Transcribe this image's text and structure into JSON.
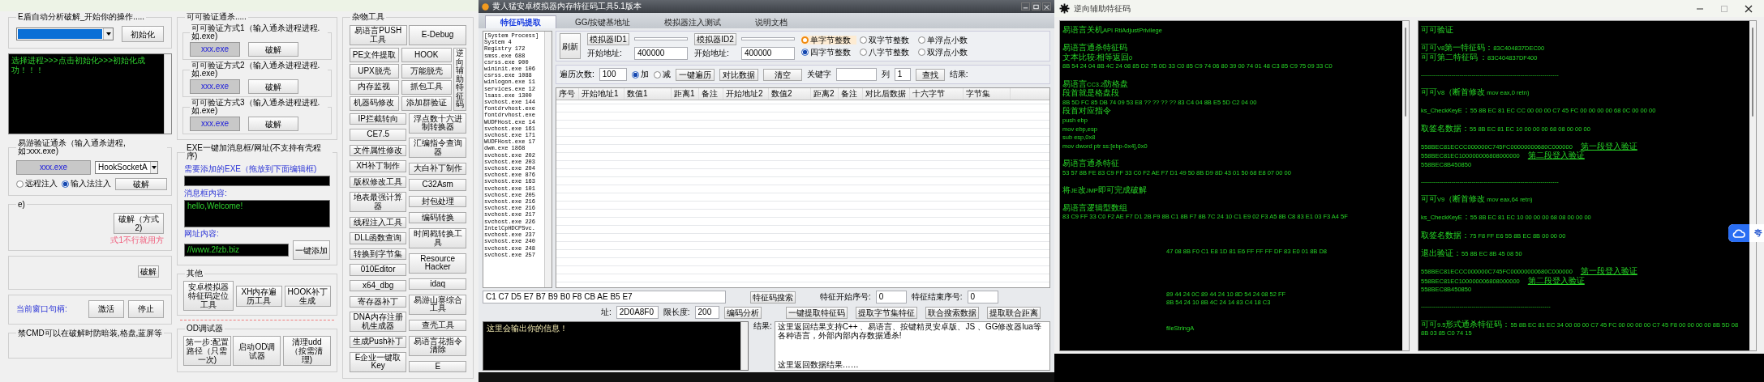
{
  "left_window": {
    "e_shield": {
      "title": "E盾自动分析破解_开始你的操作.....",
      "button": "初始化",
      "log": "选择进程>>>点击初始化>>>初始化成功！！！"
    },
    "yiyou": {
      "title": "易游验证通杀（输入通杀进程,如:xxx.exe)",
      "process": "xxx.exe",
      "hook": "HookSocketA",
      "modes": [
        {
          "label": "远程注入",
          "selected": false
        },
        {
          "label": "输入法注入",
          "selected": true
        }
      ],
      "button": "破解"
    },
    "method2": {
      "title": "e)",
      "button": "破解（方式2)",
      "hint": "式1不行就用方"
    },
    "thunder": {
      "button": "破解"
    },
    "window_ctrl": {
      "label": "当前窗口句柄:",
      "buttons": [
        "激活",
        "停止"
      ]
    },
    "cmd": {
      "title": "禁CMD可以在破解时防暗装,格盘,蓝屏等"
    },
    "keke": {
      "title": "可可验证通杀.....",
      "methods": [
        {
          "title": "可可验证方式1（输入通杀进程进程.如.exe)",
          "process": "xxx.exe",
          "button": "破解"
        },
        {
          "title": "可可验证方式2（输入通杀进程进程.如.exe)",
          "process": "xxx.exe",
          "button": "破解"
        },
        {
          "title": "可可验证方式3（输入通杀进程进程.如.exe)",
          "process": "xxx.exe",
          "button": "破解"
        }
      ]
    },
    "exe_msg": {
      "title": "EXE一键加消息框/网址(不支持有壳程序)",
      "exe_label": "需要添加的EXE（拖放到下面编辑框)",
      "msg_label": "消息框内容:",
      "msg": "hello,Welcome!",
      "url_label": "网址内容:",
      "url": "//www.2fzb.biz",
      "button": "一键添加"
    },
    "other": {
      "title": "其他",
      "buttons": [
        "安卓模拟器特征码定位工具",
        "XH内存遍历工具",
        "HOOK补丁生成"
      ]
    },
    "od": {
      "title": "OD调试器",
      "buttons": [
        "第一步:配置路径（只需一次)",
        "启动OD调试器",
        "清理udd（按需清理)"
      ]
    },
    "tools": {
      "title": "杂物工具",
      "first_row": [
        "易语言PUSH工具",
        "E-Debug"
      ],
      "grid": [
        "PE文件提取",
        "HOOK",
        "UPX脱壳",
        "万能脱壳",
        "内存监视",
        "抓包工具",
        "机器码修改",
        "添加群验证"
      ],
      "vertical": "逆向辅助特征码",
      "left_column": [
        "IP拦截转向",
        "CE7.5",
        "文件属性修改",
        "XH补丁制作",
        "版权修改工具",
        "地表最强计算器",
        "线程注入工具",
        "DLL函数查询",
        "转换到字节集",
        "010Editor",
        "x64_dbg",
        "寄存器补丁",
        "DNA内存注册机生成器",
        "生成Push补丁",
        "E企业一键取Key"
      ],
      "right_column": [
        "浮点数十六进制转换器",
        "汇编指令查询器",
        "大白补丁制作",
        "C32Asm",
        "封包处理",
        "编码转换",
        "时间戳转换工具",
        "Resource Hacker",
        "idaq",
        "易游山寨综合工具",
        "查壳工具",
        "易语言花指令清除",
        "E"
      ]
    }
  },
  "main_window": {
    "title": "黄人猛安卓模拟器内存特征码工具5.1版本",
    "tabs": [
      {
        "label": "特征码提取",
        "selected": true
      },
      {
        "label": "GG/按键基地址",
        "selected": false
      },
      {
        "label": "模拟器注入测试",
        "selected": false
      },
      {
        "label": "说明文档",
        "selected": false
      }
    ],
    "processes": [
      "[System Process]",
      "System 4",
      "Registry 172",
      "smss.exe 688",
      "csrss.exe 900",
      "wininit.exe 106",
      "csrss.exe 1088",
      "winlogon.exe 11",
      "services.exe 12",
      "lsass.exe 1300",
      "svchost.exe 144",
      "fontdrvhost.exe",
      "fontdrvhost.exe",
      "WUDFHost.exe 14",
      "svchost.exe 161",
      "svchost.exe 171",
      "WUDFHost.exe 17",
      "dwm.exe 1868",
      "svchost.exe 202",
      "svchost.exe 203",
      "svchost.exe 204",
      "svchost.exe 876",
      "svchost.exe 163",
      "svchost.exe 101",
      "svchost.exe 205",
      "svchost.exe 216",
      "svchost.exe 216",
      "svchost.exe 217",
      "svchost.exe 226",
      "IntelCpHDCPSvc.",
      "svchost.exe 237",
      "svchost.exe 240",
      "svchost.exe 248",
      "svchost.exe 257"
    ],
    "refresh": "刷新",
    "emulators": [
      {
        "button": "模拟器ID1",
        "start_label": "开始地址:",
        "start": "400000"
      },
      {
        "button": "模拟器ID2",
        "start_label": "开始地址:",
        "start": "400000"
      }
    ],
    "value_types": [
      {
        "label": "单字节整数",
        "selected": false,
        "highlighted": true
      },
      {
        "label": "双字节整数",
        "selected": false,
        "highlighted": false
      },
      {
        "label": "单浮点小数",
        "selected": false,
        "highlighted": false
      },
      {
        "label": "四字节整数",
        "selected": true,
        "highlighted": false
      },
      {
        "label": "八字节整数",
        "selected": false,
        "highlighted": false
      },
      {
        "label": "双浮点小数",
        "selected": false,
        "highlighted": false
      }
    ],
    "iterations_label": "遍历次数:",
    "iterations": "100",
    "directions": [
      {
        "label": "加",
        "selected": true
      },
      {
        "label": "减",
        "selected": false
      }
    ],
    "actions": [
      "一键遍历",
      "对比数据",
      "清空"
    ],
    "keyword_label": "关键字",
    "column_label": "列",
    "column": "1",
    "find": "查找",
    "result_label": "结果:",
    "columns": [
      "序号",
      "开始地址1",
      "数值1",
      "距离1",
      "备注",
      "开始地址2",
      "数值2",
      "距离2",
      "备注",
      "对比后数据",
      "十六字节",
      "字节集"
    ],
    "bytes": "C1 C7 D5 E7 B7 B9 B0 F8 CB AE B5 E7",
    "search": "特征码搜索",
    "feature_start_label": "特征开始序号:",
    "feature_start": "0",
    "feature_end_label": "特征结束序号:",
    "feature_end": "0",
    "address_label": "址:",
    "address": "2D0A8F0",
    "limit_label": "限长度:",
    "limit": "200",
    "analyze": "编码分析",
    "extract_buttons": [
      "一键提取特征码",
      "提取字节集特征",
      "联合搜索数据",
      "提取联合距离"
    ],
    "log": "这里会输出你的信息！",
    "output_label": "结果:",
    "output_lines": [
      "这里返回结果支持C++ 、易语言、按键精灵安卓版、JS 、GG修改器lua等各种语言，外部内部内存数据通杀!",
      "这里返回数据结果……"
    ]
  },
  "reverse_window": {
    "title": "逆向辅助特征码",
    "left_pane": [
      {
        "kind": "text",
        "text": "易语言关机API RtlAdjustPrivilege"
      },
      {
        "kind": "blank"
      },
      {
        "kind": "text",
        "text": "易语言通杀特征码"
      },
      {
        "kind": "text",
        "text": "文本比较:相等返回0"
      },
      {
        "kind": "text",
        "text": "8B 54 24 04 8B 4C 24 08 85 D2 75 0D 33 C0 85 C9 74 06 80 39 00 74 01 48 C3 85 C9 75 09 33 C0"
      },
      {
        "kind": "blank"
      },
      {
        "kind": "text",
        "text": "易语言CC3.2防格盘"
      },
      {
        "kind": "text",
        "text": "段首就是格盘段"
      },
      {
        "kind": "text",
        "text": "8B 5D FC 85 DB 74 09 53 E8 ?? ?? ?? ?? 83 C4 04 8B E5 5D C2 04 00"
      },
      {
        "kind": "text",
        "text": "段首对应指令"
      },
      {
        "kind": "text",
        "text": "push ebp"
      },
      {
        "kind": "text",
        "text": "mov ebp,esp"
      },
      {
        "kind": "text",
        "text": "sub esp,0x8"
      },
      {
        "kind": "text",
        "text": "mov dword ptr ss:[ebp-0x4],0x0"
      },
      {
        "kind": "blank"
      },
      {
        "kind": "text",
        "text": "易语言通杀特征"
      },
      {
        "kind": "text",
        "text": "53 57 8B FE 83 C9 FF 33 C0 F2 AE F7 D1 49 50 8B D9 8D 43 01 50 68 E8 07 00 00"
      },
      {
        "kind": "blank"
      },
      {
        "kind": "text",
        "text": "将JE改JMP即可完成破解"
      },
      {
        "kind": "blank"
      },
      {
        "kind": "text",
        "text": "易语言逻辑型数组"
      },
      {
        "kind": "text",
        "text": "83 C9 FF 33 C0 F2 AE F7 D1 2B F9 8B C1 8B F7 8B 7C 24 10 C1 E9 02 F3 A5 8B C8 83 E1 03 F3 A4 5F"
      },
      {
        "kind": "blank"
      },
      {
        "kind": "blank"
      },
      {
        "kind": "blank"
      },
      {
        "kind": "fragment",
        "text": "47 08 8B F0 C1 E8 1D 81 E6 FF FF FF DF 83 E0 01 8B D8"
      },
      {
        "kind": "blank"
      },
      {
        "kind": "blank"
      },
      {
        "kind": "blank"
      },
      {
        "kind": "blank"
      },
      {
        "kind": "fragment",
        "text": "89 44 24 0C 89 44 24 10 8D 54 24 08 52 FF"
      },
      {
        "kind": "fragment",
        "text": "8B 54 24 10 8B 4C 24 14 83 C4 18 C3"
      },
      {
        "kind": "blank"
      },
      {
        "kind": "blank"
      },
      {
        "kind": "fragment",
        "text": "fileStringA"
      }
    ],
    "right_pane": [
      {
        "kind": "text",
        "text": "可可验证"
      },
      {
        "kind": "blank"
      },
      {
        "kind": "text",
        "text": "可可V8第一特征码：83C404837DEC00"
      },
      {
        "kind": "text",
        "text": "可可第二特征码 ：83C404837DF400"
      },
      {
        "kind": "blank"
      },
      {
        "kind": "text",
        "text": "--------------------------------------------------------------------"
      },
      {
        "kind": "blank"
      },
      {
        "kind": "text",
        "text": "可可V8（断首修改 mov eax,0 retn)"
      },
      {
        "kind": "blank"
      },
      {
        "kind": "text",
        "text": "ks_CheckKeyE：55 8B EC 81 EC CC 00 00 00 C7 45 FC 00 00 00 00 68 0C 00 00 00"
      },
      {
        "kind": "blank"
      },
      {
        "kind": "text",
        "text": "取签名数据：55 8B EC 81 EC 10 00 00 00 68 08 00 00 00"
      },
      {
        "kind": "blank"
      },
      {
        "kind": "noted",
        "text": "558BEC81ECCC000000C745FC00000000680C000000",
        "note": "第一段登入验证"
      },
      {
        "kind": "noted",
        "text": "558BEC81EC100000006808000000",
        "note": "第二段登入验证"
      },
      {
        "kind": "text",
        "text": "558BEC8B450850"
      },
      {
        "kind": "blank"
      },
      {
        "kind": "text",
        "text": "--------------------------------------------------------------------"
      },
      {
        "kind": "blank"
      },
      {
        "kind": "text",
        "text": "可可V9（断首修改 mov eax,64 retn)"
      },
      {
        "kind": "blank"
      },
      {
        "kind": "text",
        "text": "ks_CheckKeyE：55 8B EC 81 EC 10 00 00 00 68 08 00 00 00"
      },
      {
        "kind": "blank"
      },
      {
        "kind": "text",
        "text": "取签名数据：75 F8 FF E6 55 8B EC 8B 00 00 00"
      },
      {
        "kind": "blank"
      },
      {
        "kind": "text",
        "text": "退出验证：55 8B EC 8B 45 08 50"
      },
      {
        "kind": "blank"
      },
      {
        "kind": "noted",
        "text": "558BEC81ECCC000000C745FC00000000680C000000",
        "note": "第一段登入验证"
      },
      {
        "kind": "noted",
        "text": "558BEC81EC100000006808000000",
        "note": "第二段登入验证"
      },
      {
        "kind": "text",
        "text": "558BEC8B450850"
      },
      {
        "kind": "blank"
      },
      {
        "kind": "text",
        "text": "----------------------------------------------------------------"
      },
      {
        "kind": "blank"
      },
      {
        "kind": "text",
        "text": "可可9.5形式通杀特征码：55 8B EC 81 EC 34 00 00 00 C7 45 FC 00 00 00 00 C7 45 F8 00 00 00 00 8B 5D 08 8B 03 85 C0 74 15"
      }
    ]
  },
  "quark_widget": {
    "label": "夸"
  }
}
